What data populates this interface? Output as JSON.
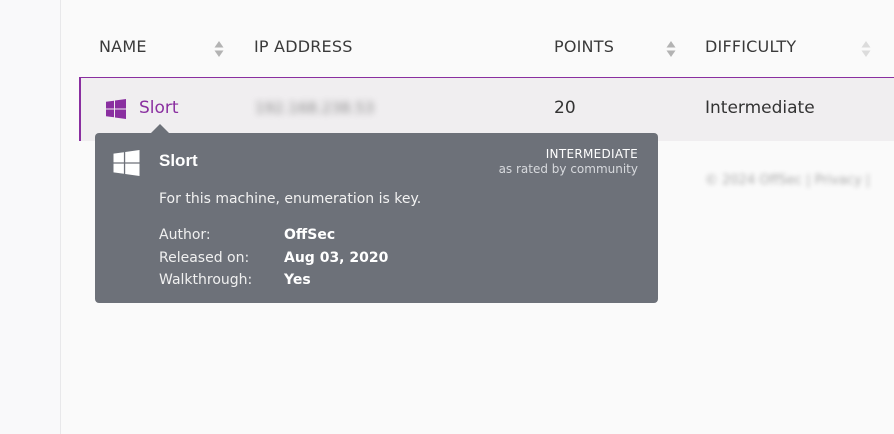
{
  "table": {
    "columns": {
      "name": "NAME",
      "ip": "IP ADDRESS",
      "points": "POINTS",
      "difficulty": "DIFFICULTY"
    },
    "row": {
      "os_icon": "windows-icon",
      "name": "Slort",
      "ip": "192.168.238.53",
      "points": "20",
      "difficulty": "Intermediate"
    }
  },
  "footer_blurred": "© 2024 OffSec | Privacy |",
  "tooltip": {
    "os_icon": "windows-icon",
    "title": "Slort",
    "difficulty": "INTERMEDIATE",
    "rated_by": "as rated by community",
    "description": "For this machine, enumeration is key.",
    "author_label": "Author:",
    "author_value": "OffSec",
    "released_label": "Released on:",
    "released_value": "Aug 03, 2020",
    "walkthrough_label": "Walkthrough:",
    "walkthrough_value": "Yes"
  },
  "colors": {
    "accent": "#8a2fa0",
    "tooltip_bg": "#6d7179"
  }
}
